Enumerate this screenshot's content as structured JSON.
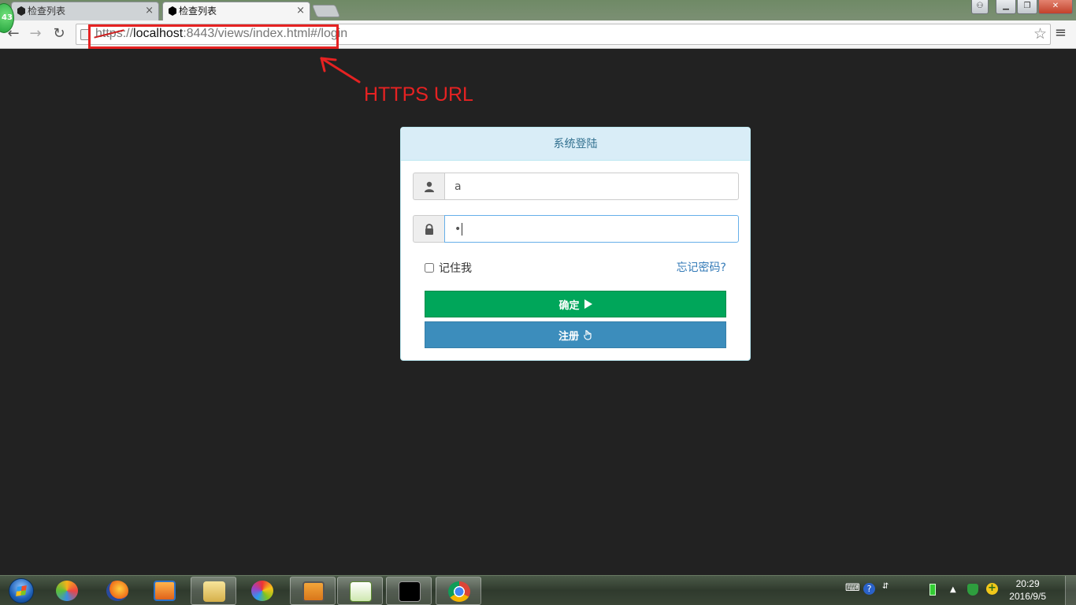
{
  "browser": {
    "tabs": [
      {
        "title": "检查列表",
        "active": false
      },
      {
        "title": "检查列表",
        "active": true
      }
    ],
    "badge_count": "43",
    "url": {
      "scheme": "https",
      "separator": "://",
      "host": "localhost",
      "rest": ":8443/views/index.html#/login"
    },
    "icons": {
      "back": "back-arrow-icon",
      "forward": "forward-arrow-icon",
      "reload": "reload-icon",
      "star": "star-icon",
      "menu": "hamburger-menu-icon"
    }
  },
  "annotation": {
    "label": "HTTPS URL",
    "color": "#e62222"
  },
  "login": {
    "heading": "系统登陆",
    "username_value": "a",
    "password_value": "•",
    "remember_label": "记住我",
    "forgot_label": "忘记密码?",
    "confirm_label": "确定",
    "register_label": "注册",
    "colors": {
      "heading_bg": "#d9edf7",
      "heading_text": "#31708f",
      "confirm": "#00a65a",
      "register": "#3c8dbc"
    }
  },
  "taskbar": {
    "time": "20:29",
    "date": "2016/9/5"
  }
}
